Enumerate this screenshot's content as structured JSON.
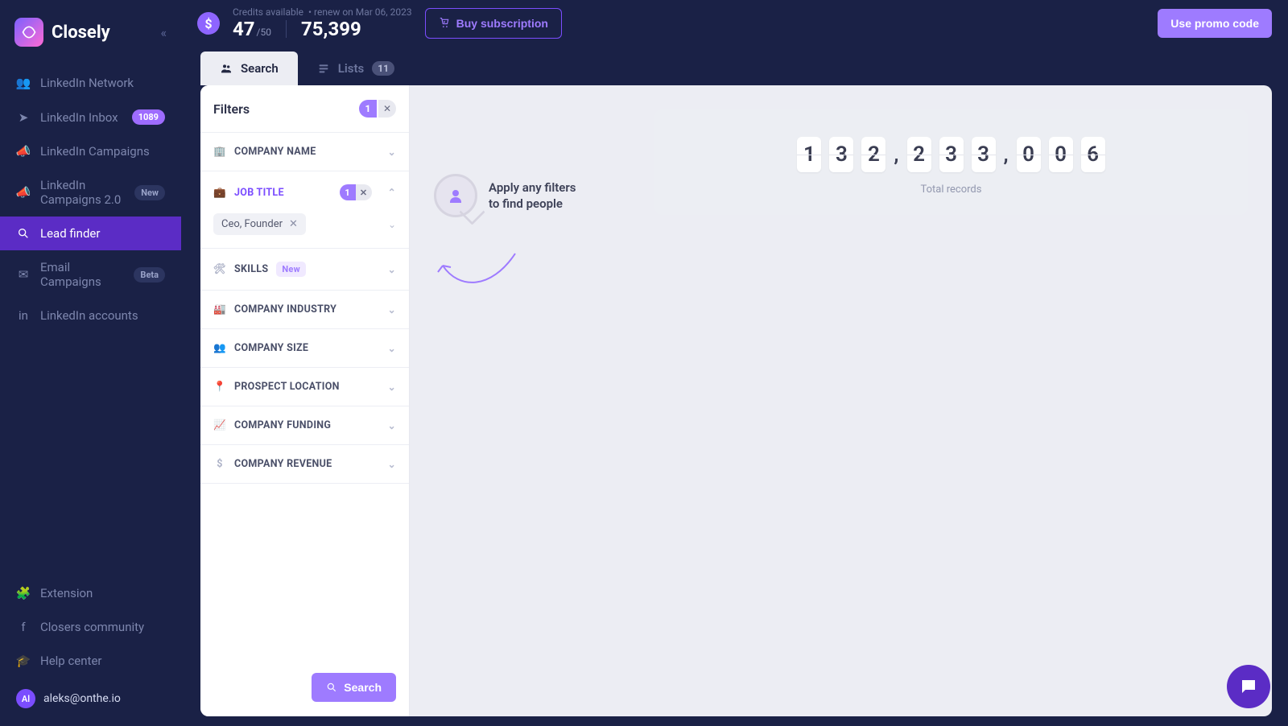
{
  "brand": {
    "name": "Closely"
  },
  "sidebar": {
    "items": [
      {
        "label": "LinkedIn Network"
      },
      {
        "label": "LinkedIn Inbox",
        "badge": "1089"
      },
      {
        "label": "LinkedIn Campaigns"
      },
      {
        "label": "LinkedIn Campaigns 2.0",
        "badge": "New",
        "muted": true
      },
      {
        "label": "Lead finder"
      },
      {
        "label": "Email Campaigns",
        "badge": "Beta",
        "muted": true
      },
      {
        "label": "LinkedIn accounts"
      }
    ],
    "footer": [
      {
        "label": "Extension"
      },
      {
        "label": "Closers community"
      },
      {
        "label": "Help center"
      }
    ]
  },
  "user": {
    "initials": "Al",
    "email": "aleks@onthe.io"
  },
  "topbar": {
    "credits_label": "Credits available",
    "renew_text": "• renew on Mar 06, 2023",
    "value": "47",
    "denom": "/50",
    "value2": "75,399",
    "buy_label": "Buy subscription",
    "promo_label": "Use promo code"
  },
  "tabs": {
    "search": "Search",
    "lists": "Lists",
    "lists_count": "11"
  },
  "filters": {
    "title": "Filters",
    "count": "1",
    "sections": {
      "company_name": "COMPANY NAME",
      "job_title": "JOB TITLE",
      "job_title_count": "1",
      "job_title_tag": "Ceo, Founder",
      "skills": "SKILLS",
      "skills_new": "New",
      "company_industry": "COMPANY INDUSTRY",
      "company_size": "COMPANY SIZE",
      "prospect_location": "PROSPECT LOCATION",
      "company_funding": "COMPANY FUNDING",
      "company_revenue": "COMPANY REVENUE"
    },
    "search_button": "Search"
  },
  "hint": {
    "text": "Apply any filters to find people"
  },
  "records": {
    "digits": [
      "1",
      "3",
      "2",
      "2",
      "3",
      "3",
      "0",
      "0",
      "6"
    ],
    "label": "Total records"
  }
}
